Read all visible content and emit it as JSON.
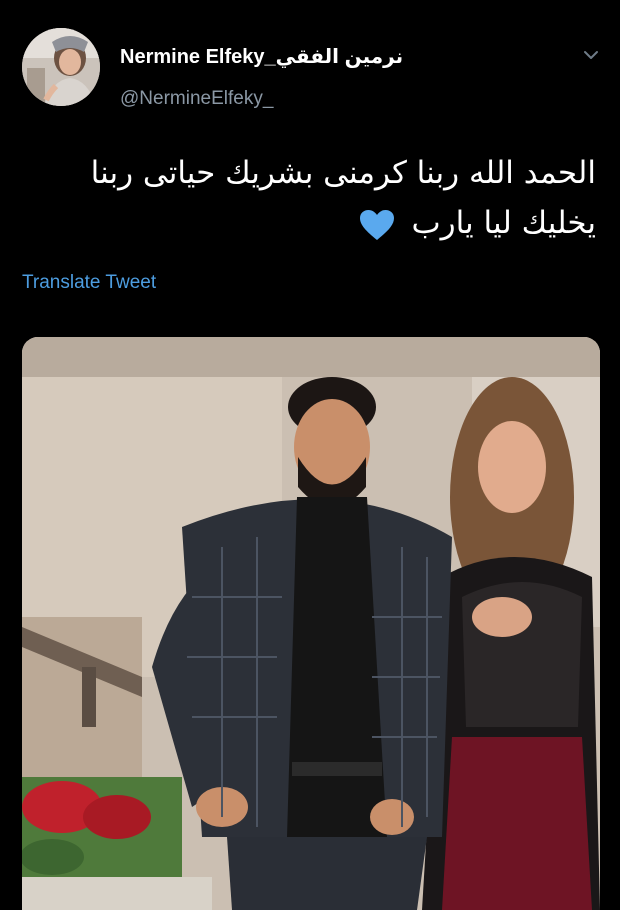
{
  "tweet": {
    "display_name": "Nermine Elfeky_نرمين الفقي",
    "handle": "@NermineElfeky_",
    "text_line1": "الحمد الله ربنا كرمنى بشريك حياتى ربنا",
    "text_line2": "يخليك ليا يارب",
    "translate_label": "Translate Tweet"
  },
  "icons": {
    "avatar": "avatar-photo",
    "more": "chevron-down-icon",
    "emoji": "blue-heart-icon"
  },
  "colors": {
    "background": "#000000",
    "handle": "#8b98a5",
    "link": "#4d9de0",
    "heart": "#5aa9ee"
  }
}
